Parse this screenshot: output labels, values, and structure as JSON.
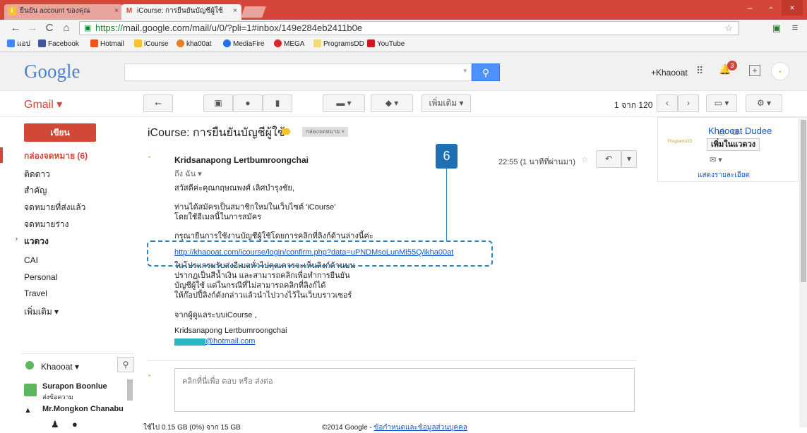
{
  "browser": {
    "tabs": [
      {
        "title": "ยืนยัน account ของคุณ"
      },
      {
        "title": "iCourse: การยืนยันบัญชีผู้ใช้"
      }
    ],
    "tab_close": "×",
    "url_secure": "https://",
    "url_rest": "mail.google.com/mail/u/0/?pli=1#inbox/149e284eb2411b0e",
    "bookmarks": [
      "แอป",
      "Facebook",
      "Hotmail",
      "iCourse",
      "kha00at",
      "MediaFire",
      "MEGA",
      "ProgramsDD",
      "YouTube"
    ]
  },
  "google": {
    "logo": "Google",
    "user": "+Khaooat",
    "notif_count": "3"
  },
  "gmail": {
    "label": "Gmail ▾",
    "more_label": "เพิ่มเติม ▾",
    "pager": "1 จาก 120",
    "compose": "เขียน",
    "nav": [
      "กล่องจดหมาย (6)",
      "ติดดาว",
      "สำคัญ",
      "จดหมายที่ส่งแล้ว",
      "จดหมายร่าง",
      "แวดวง",
      "CAI",
      "Personal",
      "Travel",
      "เพิ่มเติม ▾"
    ],
    "chat_user": "Khaooat ▾",
    "contacts": [
      {
        "name": "Surapon Boonlue",
        "status": "ส่งข้อความ"
      },
      {
        "name": "Mr.Mongkon Chanabu",
        "status": ""
      }
    ]
  },
  "message": {
    "subject": "iCourse: การยืนยันบัญชีผู้ใช้",
    "label_tag": "กล่องจดหมาย ×",
    "sender": "Kridsanapong Lertbumroongchai",
    "to_me": "ถึง ฉัน",
    "time": "22:55 (1 นาทีที่ผ่านมา)",
    "body": [
      "สวัสดีค่ะคุณกฤษณพงศ์ เลิศบำรุงชัย,",
      "ท่านได้สมัครเป็นสมาชิกใหม่ในเว็บไซต์ 'iCourse'",
      "โดยใช้อีเมลนี้ในการสมัคร",
      "กรุณายืนการใช้งานบัญชีผู้ใช้โดยการคลิกที่ลิงก์ด้านล่างนี้ค่ะ",
      "http://khaooat.com/icourse/login/confirm.php?data=uPNDMsoLunMi55Q/ikha00at",
      "ในโปรแกรมรับส่งอีเมลทั่วไปคุณควรจะเห็นลิงก์ด้านบน",
      "ปรากฏเป็นสีน้ำเงิน และสามารถคลิกเพื่อทำการยืนยัน",
      "บัญชีผู้ใช้ แต่ในกรณีที่ไม่สามารถคลิกที่ลิงก์ได้",
      "ให้ก๊อปปี้ลิงก์ดังกล่าวแล้วนำไปวางไว้ในเว็บบราวเซอร์",
      "จากผู้ดูแลระบบiCourse ,",
      "Kridsanapong Lertbumroongchai",
      "@hotmail.com"
    ],
    "reply_prompt": "คลิกที่นี่เพื่อ ตอบ หรือ ส่งต่อ"
  },
  "sidebar_contact": {
    "name": "Khaooat Dudee",
    "add_button": "เพิ่มในแวดวง",
    "details": "แสดงรายละเอียด",
    "brand": "ProgramsDD"
  },
  "footer": {
    "storage": "ใช้ไป 0.15 GB (0%) จาก 15 GB",
    "copyright": "©2014 Google - ",
    "terms": "ข้อกำหนดและข้อมูลส่วนบุคคล"
  },
  "annotation": {
    "step": "6"
  },
  "colors": {
    "chrome_titlebar": "#d4453a",
    "compose": "#d14836",
    "search_button": "#4d90fe",
    "callout": "#1f6fb4",
    "link": "#1155cc"
  }
}
